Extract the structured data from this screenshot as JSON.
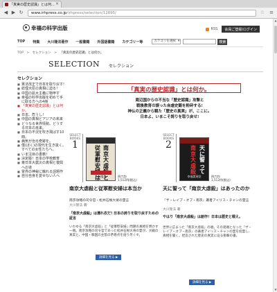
{
  "browser": {
    "tab_title": "「真実の歴史認識」とは何...",
    "tab_close": "×",
    "url_host": "www.irhpress.co.jp",
    "url_path": "/irhpress/selection/12895/"
  },
  "header": {
    "logo_text": "幸福の科学出版",
    "rss": "RSS",
    "member": "会員ご登録/ログイン"
  },
  "nav": {
    "items": [
      "TOP",
      "特集",
      "大川隆法著作",
      "一般書籍",
      "外国語書籍",
      "カテゴリー等"
    ],
    "category_select": "カテゴリを選択",
    "search_button": "検索"
  },
  "breadcrumb": {
    "items": [
      "TOP",
      ">",
      "セレクション",
      ">"
    ],
    "current": "「真実の歴史認識」とは何か。"
  },
  "banner": {
    "en": "SELECTION",
    "jp": "セレクション"
  },
  "sidebar": {
    "heading": "セレクション",
    "items": [
      {
        "label": "憲法改正で日本を取り戻す!",
        "active": false
      },
      {
        "label": "総理大臣の真相に迫る！",
        "active": false
      },
      {
        "label": "中国の拡大主義に物申す",
        "active": false
      },
      {
        "label": "幸福の科学出版を初めて手に取る方への4冊",
        "active": false
      },
      {
        "label": "「真実の歴史認識」とは何か。",
        "active": true
      },
      {
        "label": "日本、危うし！",
        "active": false
      },
      {
        "label": "中国の真相とアジアの未来",
        "active": false
      },
      {
        "label": "どうなる世界情勢。どうする日本の未来。",
        "active": false
      },
      {
        "label": "日本の不況を吹き飛ばす10冊。",
        "active": false
      },
      {
        "label": "病気が治る奇跡を。",
        "active": false
      },
      {
        "label": "僕(ぼく)の現代を生き抜く。すべての女性たちへ。",
        "active": false
      },
      {
        "label": "いま注目の書籍！",
        "active": false
      },
      {
        "label": "決定版！日本の学校教育",
        "active": false
      },
      {
        "label": "東日本大震災の真相と復興への道",
        "active": false
      },
      {
        "label": "霊界の神秘に触れる話題作",
        "active": false
      },
      {
        "label": "自分自身を愛せない人へ",
        "active": false
      }
    ]
  },
  "main": {
    "title": "「真実の歴史認識」とは何か。",
    "intro": [
      "周辺国からの不当な「歴史認識」攻撃と",
      "戦後教育の誤った自虐史観を粉砕する!",
      "神仏の正義から観た「歴史の真実」が、ここに。",
      "日本よ、いまこそ誇りを取り戻せ!"
    ],
    "books": [
      {
        "label": "SELECT BOOKS",
        "number": "1",
        "cover_title": "南京大虐殺と従軍慰安婦は本当か",
        "cover_pub": "大川隆法",
        "meta": [
          "四六判",
          "1,512円(税込)"
        ],
        "title": "南京大虐殺と従軍慰安婦は本当か",
        "sub": "南京攻略の司令官・松井石根大将の霊言",
        "author": "大川隆法 著",
        "tagline": "「南京大虐殺」は濡れ衣だ!\n日本の誇りを取り戻すための証言",
        "body": "いわゆる「南京大虐殺」と「従軍慰安婦」問題の真相を明かす一冊。南京攻略の司令官であった松井石根大将の霊が、大戦の真実と、中国・韓国の主張の矛盾点を語り尽くす。",
        "more": "詳細を見る ▶"
      },
      {
        "label": "SELECT BOOKS",
        "number": "2",
        "cover_title": "天に誓って南京大虐殺はあったのか",
        "cover_pub": "幸福実現党",
        "meta": [
          "四六判",
          "1,512円(税込)"
        ],
        "title": "天に誓って「南京大虐殺」はあったのか",
        "sub": "『ザ・レイプ・オブ・南京』著者アイリス・チャンの霊言",
        "author": "大川隆法 著",
        "tagline": "やはり「南京大虐殺」は創作！日本は歴史と戦え。",
        "body": "世界に広まった「南京大虐殺」の嘘。その発端となった『ザ・レイプ・オブ・南京』の著者アイリス・チャンの霊を招霊し、真相を聞く。捏造された歴史の真実に迫る衝撃の書。",
        "more": "詳細を見る ▶"
      }
    ]
  }
}
